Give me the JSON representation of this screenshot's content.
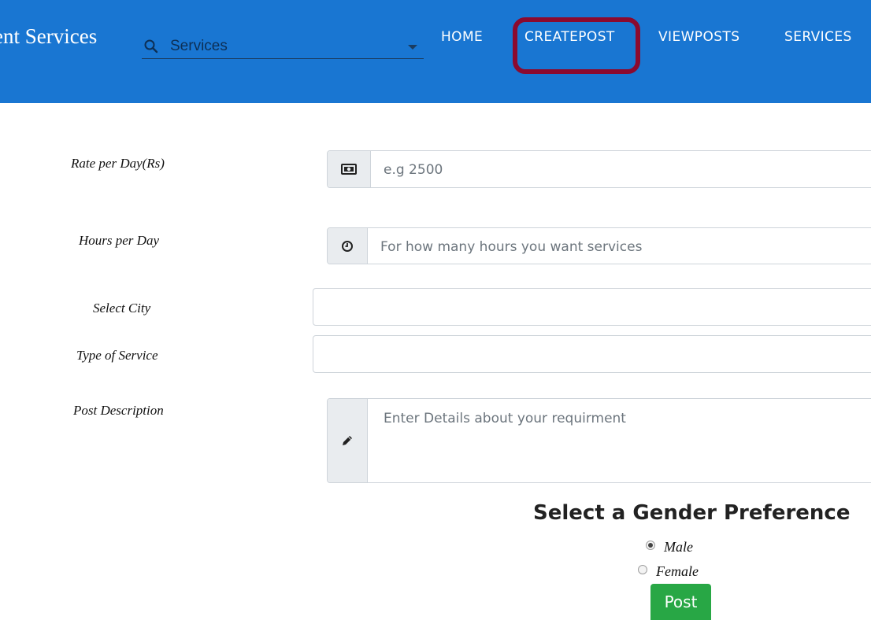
{
  "header": {
    "brand": "ent Services",
    "search": {
      "value": "Services"
    },
    "nav": {
      "home": "HOME",
      "createpost": "CREATEPOST",
      "viewposts": "VIEWPOSTS",
      "services": "SERVICES"
    },
    "highlight_color": "#8b0a2f",
    "background_color": "#1976d2"
  },
  "form": {
    "rate": {
      "label": "Rate per Day(Rs)",
      "placeholder": "e.g 2500",
      "icon": "money-icon"
    },
    "hours": {
      "label": "Hours per Day",
      "placeholder": "For how many hours you want services",
      "icon": "clock-icon"
    },
    "city": {
      "label": "Select City",
      "value": ""
    },
    "service_type": {
      "label": "Type of Service",
      "value": ""
    },
    "description": {
      "label": "Post Description",
      "placeholder": "Enter Details about your requirment",
      "icon": "pencil-icon"
    }
  },
  "gender": {
    "title": "Select a Gender Preference",
    "options": [
      {
        "label": "Male",
        "selected": true
      },
      {
        "label": "Female",
        "selected": false
      }
    ]
  },
  "submit": {
    "label": "Post",
    "color": "#28a745"
  }
}
